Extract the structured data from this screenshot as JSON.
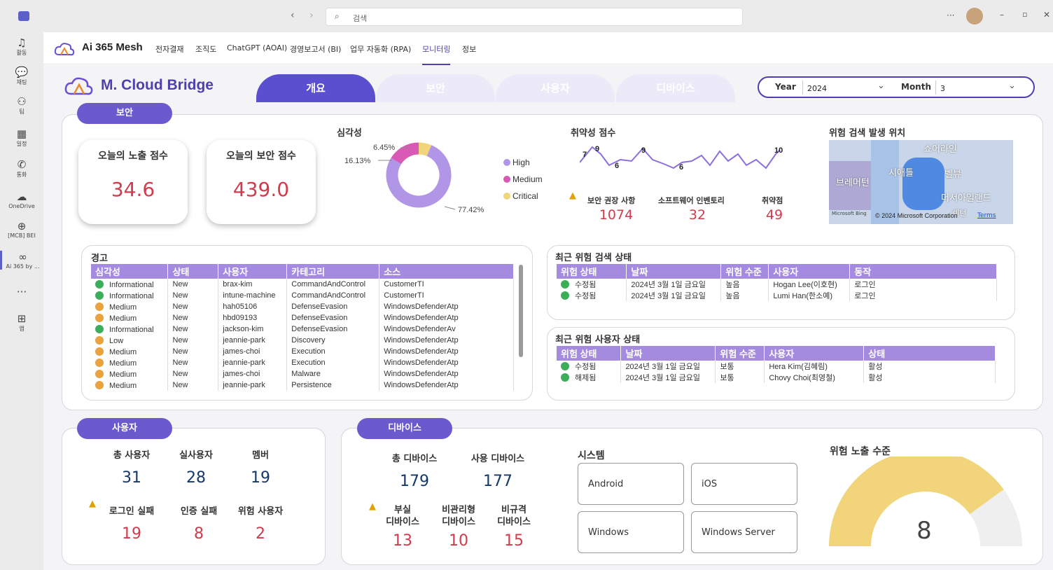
{
  "titlebar": {
    "search_placeholder": "검색",
    "more": "···"
  },
  "rail": [
    {
      "label": "활동",
      "icon": "bell-icon",
      "glyph": "♫"
    },
    {
      "label": "채팅",
      "icon": "chat-icon",
      "glyph": "💬"
    },
    {
      "label": "팀",
      "icon": "teams-icon",
      "glyph": "⚇"
    },
    {
      "label": "일정",
      "icon": "calendar-icon",
      "glyph": "▦"
    },
    {
      "label": "통화",
      "icon": "phone-icon",
      "glyph": "✆"
    },
    {
      "label": "OneDrive",
      "icon": "cloud-icon",
      "glyph": "☁"
    },
    {
      "label": "[MCB] BEI",
      "icon": "globe-icon",
      "glyph": "⊕"
    },
    {
      "label": "Ai 365 by ...",
      "icon": "ai365-icon",
      "glyph": "∞"
    },
    {
      "label": "",
      "icon": "more-icon",
      "glyph": "···"
    },
    {
      "label": "앱",
      "icon": "apps-icon",
      "glyph": "⊞"
    }
  ],
  "appnav": {
    "brand": "Ai 365 Mesh",
    "links": [
      "전자결재",
      "조직도",
      "ChatGPT (AOAI)",
      "경영보고서 (BI)",
      "업무 자동화 (RPA)",
      "모니터링",
      "정보"
    ],
    "active_index": 5
  },
  "header": {
    "logo": "M. Cloud Bridge",
    "tabs": [
      "개요",
      "보안",
      "사용자",
      "디바이스"
    ],
    "active_tab": 0,
    "year_label": "Year",
    "year_value": "2024",
    "month_label": "Month",
    "month_value": "3"
  },
  "security": {
    "pill": "보안",
    "exposure_label": "오늘의 노출 점수",
    "exposure_value": "34.6",
    "security_label": "오늘의 보안 점수",
    "security_value": "439.0",
    "severity_title": "심각성",
    "severity": {
      "labels": [
        "6.45%",
        "16.13%",
        "77.42%"
      ],
      "legend": [
        "High",
        "Medium",
        "Critical"
      ],
      "colors": [
        "#b195e6",
        "#d95ab4",
        "#f2d57a"
      ],
      "values": [
        77.42,
        16.13,
        6.45
      ]
    },
    "vuln_title": "취약성 점수",
    "vuln_labels": [
      "7",
      "9",
      "6",
      "9",
      "6",
      "10"
    ],
    "rec_label": "보안 권장 사항",
    "rec_value": "1074",
    "sw_label": "소프트웨어 인벤토리",
    "sw_value": "32",
    "vuln_label": "취약점",
    "vuln_value": "49",
    "map_title": "위험 검색 발생 위치",
    "map_places": [
      "쇼어라인",
      "시애틀",
      "벨뷰",
      "브레머턴",
      "머서아일랜드",
      "렌턴"
    ],
    "map_credit": "© 2024 Microsoft Corporation",
    "map_terms": "Terms",
    "map_brand": "Microsoft Bing"
  },
  "alerts": {
    "title": "경고",
    "headers": [
      "심각성",
      "상태",
      "사용자",
      "카테고리",
      "소스"
    ],
    "rows": [
      [
        "Informational",
        "New",
        "brax-kim",
        "CommandAndControl",
        "CustomerTI",
        "#3cae5a"
      ],
      [
        "Informational",
        "New",
        "intune-machine",
        "CommandAndControl",
        "CustomerTI",
        "#3cae5a"
      ],
      [
        "Medium",
        "New",
        "hah05106",
        "DefenseEvasion",
        "WindowsDefenderAtp",
        "#e8a23e"
      ],
      [
        "Medium",
        "New",
        "hbd09193",
        "DefenseEvasion",
        "WindowsDefenderAtp",
        "#e8a23e"
      ],
      [
        "Informational",
        "New",
        "jackson-kim",
        "DefenseEvasion",
        "WindowsDefenderAv",
        "#3cae5a"
      ],
      [
        "Low",
        "New",
        "jeannie-park",
        "Discovery",
        "WindowsDefenderAtp",
        "#e8a23e"
      ],
      [
        "Medium",
        "New",
        "james-choi",
        "Execution",
        "WindowsDefenderAtp",
        "#e8a23e"
      ],
      [
        "Medium",
        "New",
        "jeannie-park",
        "Execution",
        "WindowsDefenderAtp",
        "#e8a23e"
      ],
      [
        "Medium",
        "New",
        "james-choi",
        "Malware",
        "WindowsDefenderAtp",
        "#e8a23e"
      ],
      [
        "Medium",
        "New",
        "jeannie-park",
        "Persistence",
        "WindowsDefenderAtp",
        "#e8a23e"
      ]
    ]
  },
  "threats": {
    "title": "최근 위험 검색 상태",
    "headers": [
      "위험 상태",
      "날짜",
      "위험 수준",
      "사용자",
      "동작"
    ],
    "rows": [
      [
        "수정됨",
        "2024년 3월 1일 금요일",
        "높음",
        "Hogan Lee(이호현)",
        "로그인"
      ],
      [
        "수정됨",
        "2024년 3월 1일 금요일",
        "높음",
        "Lumi Han(한소예)",
        "로그인"
      ]
    ]
  },
  "risky_users": {
    "title": "최근 위험 사용자 상태",
    "headers": [
      "위험 상태",
      "날짜",
      "위험 수준",
      "사용자",
      "상태"
    ],
    "rows": [
      [
        "수정됨",
        "2024년 3월 1일 금요일",
        "보통",
        "Hera Kim(김혜림)",
        "활성"
      ],
      [
        "해제됨",
        "2024년 3월 1일 금요일",
        "보통",
        "Chovy Choi(최영철)",
        "활성"
      ]
    ]
  },
  "users": {
    "pill": "사용자",
    "total_label": "총 사용자",
    "total": "31",
    "real_label": "실사용자",
    "real": "28",
    "member_label": "멤버",
    "member": "19",
    "login_fail_label": "로그인 실패",
    "login_fail": "19",
    "auth_fail_label": "인증 실패",
    "auth_fail": "8",
    "risk_label": "위험 사용자",
    "risk": "2"
  },
  "devices": {
    "pill": "디바이스",
    "total_label": "총 디바이스",
    "total": "179",
    "used_label": "사용 디바이스",
    "used": "177",
    "lost_label": "부실\n디바이스",
    "lost": "13",
    "unmanaged_label": "비관리형\n디바이스",
    "unmanaged": "10",
    "noncompliant_label": "비규격\n디바이스",
    "noncompliant": "15",
    "system_title": "시스템",
    "systems": [
      "Android",
      "iOS",
      "Windows",
      "Windows Server"
    ],
    "gauge_title": "위험 노출 수준",
    "gauge_value": "8",
    "gauge_fraction": 0.8
  }
}
